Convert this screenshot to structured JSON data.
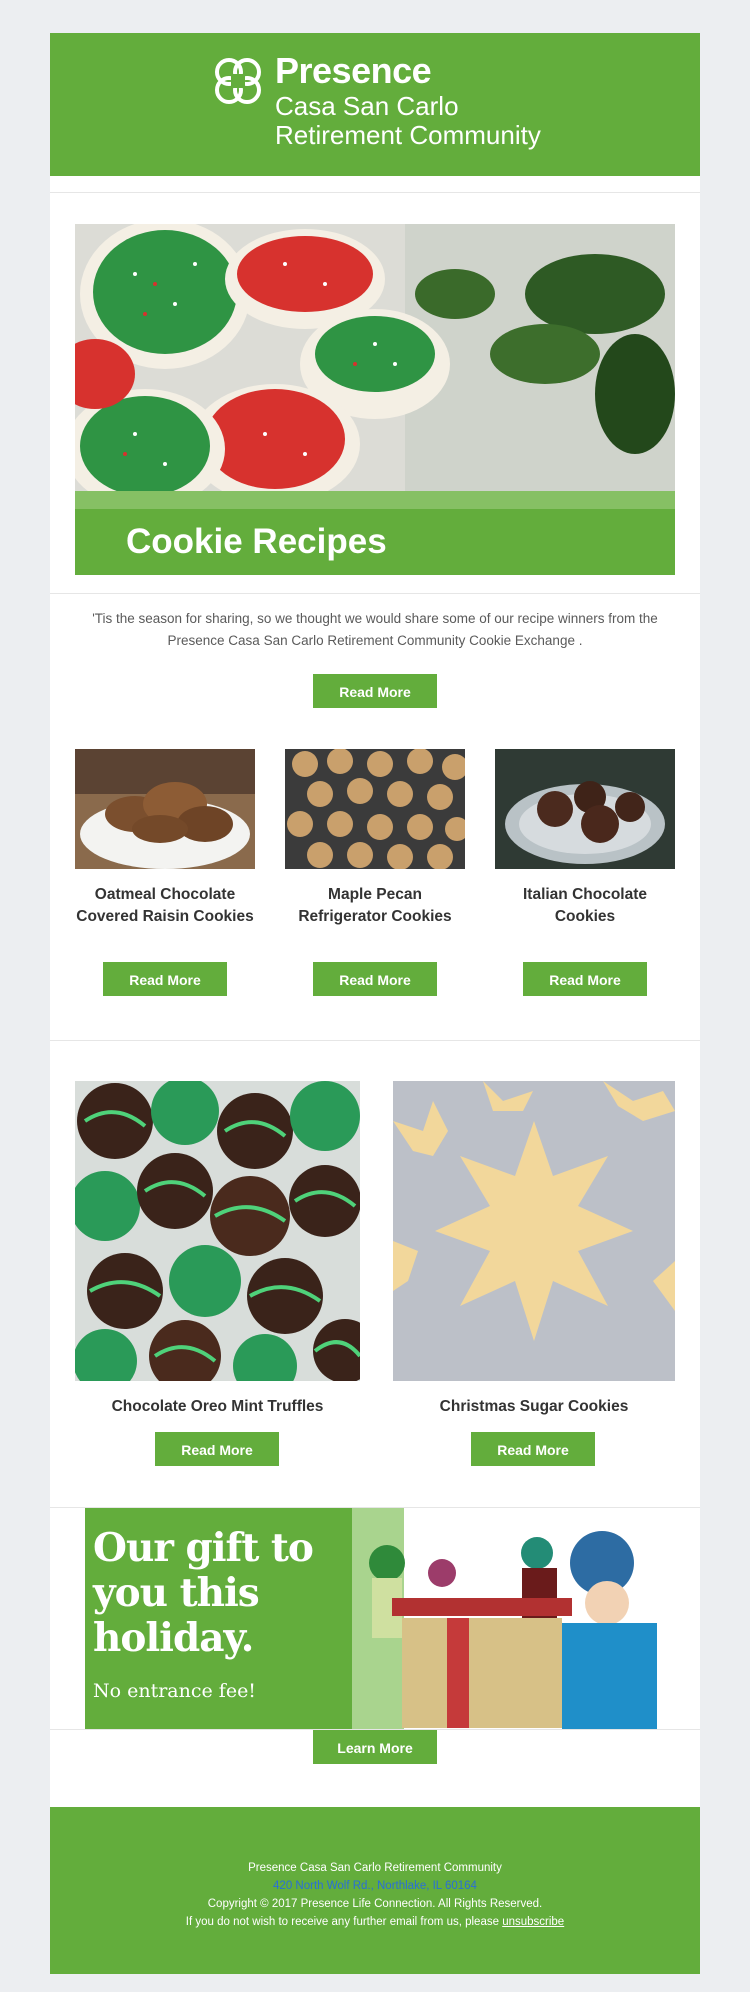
{
  "header": {
    "brand_name": "Presence",
    "brand_line2": "Casa San Carlo",
    "brand_line3": "Retirement Community"
  },
  "hero": {
    "title": "Cookie Recipes",
    "image_icon": "holiday-cookies-photo"
  },
  "intro": {
    "text": "'Tis the season for sharing, so we thought we would share some of our recipe winners from the Presence Casa San Carlo Retirement Community Cookie Exchange .",
    "button": "Read More"
  },
  "recipes_row1": [
    {
      "title": "Oatmeal Chocolate Covered Raisin Cookies",
      "button": "Read More"
    },
    {
      "title": "Maple Pecan Refrigerator Cookies",
      "button": "Read More"
    },
    {
      "title": "Italian Chocolate Cookies",
      "button": "Read More"
    }
  ],
  "recipes_row2": [
    {
      "title": "Chocolate Oreo Mint Truffles",
      "button": "Read More"
    },
    {
      "title": "Christmas Sugar Cookies",
      "button": "Read More"
    }
  ],
  "gift": {
    "headline_1": "Our gift to",
    "headline_2": "you this",
    "headline_3": "holiday.",
    "subline": "No entrance fee!",
    "button": "Learn More"
  },
  "footer": {
    "org": "Presence Casa San Carlo Retirement Community",
    "address": "420 North Wolf Rd., Northlake, IL 60164",
    "copyright": "Copyright © 2017  Presence Life Connection. All Rights Reserved.",
    "unsub_prefix": "If you do not wish to receive any further email from us, please ",
    "unsub_link": "unsubscribe"
  },
  "colors": {
    "brand_green": "#63ad3c",
    "page_bg": "#eceef1",
    "link_blue": "#2a6fd6"
  }
}
